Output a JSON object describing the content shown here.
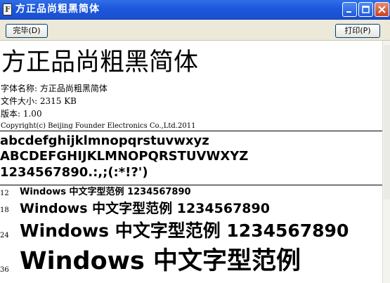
{
  "window": {
    "title": "方正品尚粗黑简体",
    "icon": "font-file-icon"
  },
  "toolbar": {
    "done_label": "完毕(D)",
    "print_label": "打印(P)"
  },
  "preview": {
    "font_name_display": "方正品尚粗黑简体",
    "font_name_line": "字体名称: 方正品尚粗黑简体",
    "file_size_line": "文件大小: 2315 KB",
    "version_line": "版本: 1.00",
    "copyright_line": "Copyright(c) Beijing Founder Electronics Co.,Ltd.2011",
    "lowercase": "abcdefghijklmnopqrstuvwxyz",
    "uppercase": "ABCDEFGHIJKLMNOPQRSTUVWXYZ",
    "digits": "1234567890.:,;(:*!?')",
    "samples": [
      {
        "size": "12",
        "text": "Windows 中文字型范例 1234567890"
      },
      {
        "size": "18",
        "text": "Windows 中文字型范例 1234567890"
      },
      {
        "size": "24",
        "text": "Windows 中文字型范例 1234567890"
      },
      {
        "size": "36",
        "text": "Windows 中文字型范例"
      }
    ]
  },
  "colors": {
    "titlebar": "#1e57dc",
    "toolbar_bg": "#ece9d8",
    "close_button": "#c6421f"
  }
}
